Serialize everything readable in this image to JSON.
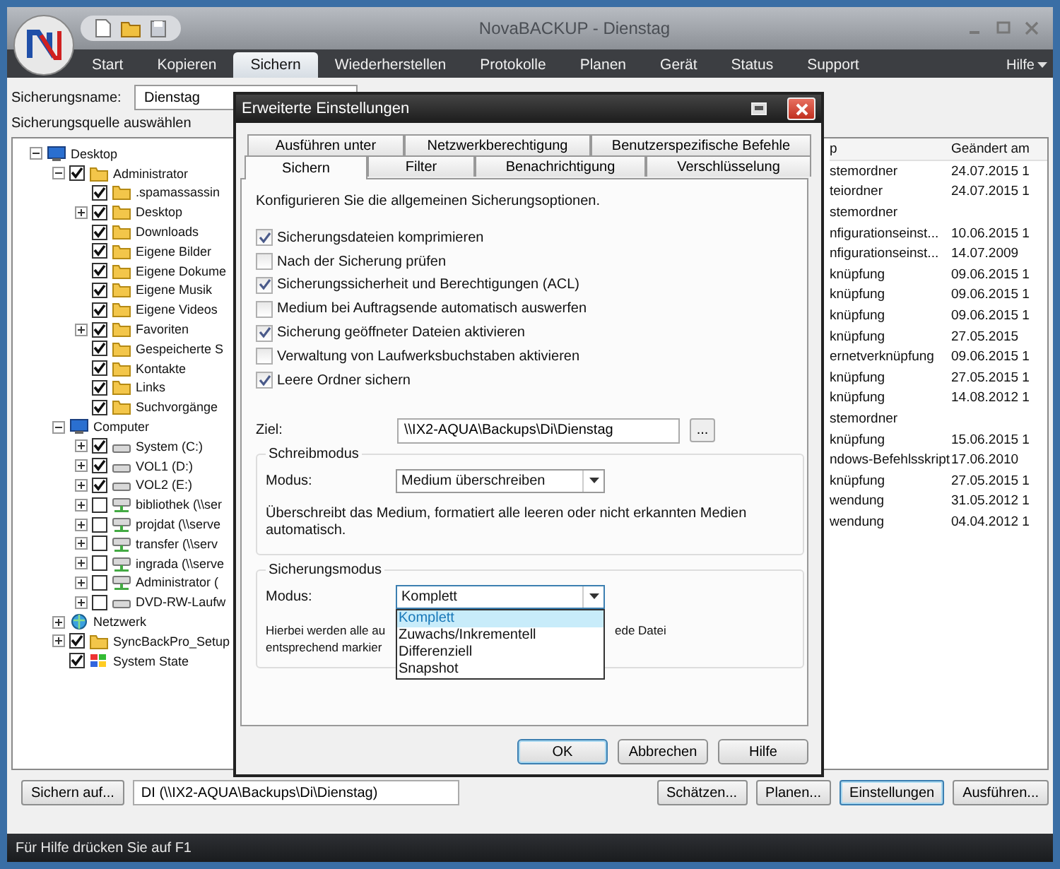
{
  "window": {
    "title": "NovaBACKUP - Dienstag"
  },
  "menu": {
    "tabs": [
      {
        "label": "Start",
        "selected": false
      },
      {
        "label": "Kopieren",
        "selected": false
      },
      {
        "label": "Sichern",
        "selected": true
      },
      {
        "label": "Wiederherstellen",
        "selected": false
      },
      {
        "label": "Protokolle",
        "selected": false
      },
      {
        "label": "Planen",
        "selected": false
      },
      {
        "label": "Gerät",
        "selected": false
      },
      {
        "label": "Status",
        "selected": false
      },
      {
        "label": "Support",
        "selected": false
      }
    ],
    "help": "Hilfe"
  },
  "backup_name": {
    "label": "Sicherungsname:",
    "value": "Dienstag"
  },
  "source_label": "Sicherungsquelle auswählen",
  "tree": [
    {
      "label": "Desktop",
      "kind": "desktop",
      "expanded": true,
      "children": [
        {
          "label": "Administrator",
          "kind": "folder",
          "checked": true,
          "expanded": true,
          "children": [
            {
              "label": ".spamassassin",
              "kind": "folder",
              "checked": true
            },
            {
              "label": "Desktop",
              "kind": "folder",
              "checked": true,
              "expanded": false
            },
            {
              "label": "Downloads",
              "kind": "folder",
              "checked": true
            },
            {
              "label": "Eigene Bilder",
              "kind": "folder",
              "checked": true
            },
            {
              "label": "Eigene Dokume",
              "kind": "folder",
              "checked": true
            },
            {
              "label": "Eigene Musik",
              "kind": "folder",
              "checked": true
            },
            {
              "label": "Eigene Videos",
              "kind": "folder",
              "checked": true
            },
            {
              "label": "Favoriten",
              "kind": "folder",
              "checked": true,
              "expanded": false
            },
            {
              "label": "Gespeicherte S",
              "kind": "folder",
              "checked": true
            },
            {
              "label": "Kontakte",
              "kind": "folder",
              "checked": true
            },
            {
              "label": "Links",
              "kind": "folder",
              "checked": true
            },
            {
              "label": "Suchvorgänge",
              "kind": "folder",
              "checked": true
            }
          ]
        },
        {
          "label": "Computer",
          "kind": "desktop",
          "expanded": true,
          "children": [
            {
              "label": "System (C:)",
              "kind": "drive",
              "checked": true,
              "expanded": false
            },
            {
              "label": "VOL1 (D:)",
              "kind": "drive",
              "checked": true,
              "expanded": false
            },
            {
              "label": "VOL2 (E:)",
              "kind": "drive",
              "checked": true,
              "expanded": false
            },
            {
              "label": "bibliothek (\\\\ser",
              "kind": "netdrive",
              "checked": false,
              "expanded": false
            },
            {
              "label": "projdat (\\\\serve",
              "kind": "netdrive",
              "checked": false,
              "expanded": false
            },
            {
              "label": "transfer (\\\\serv",
              "kind": "netdrive",
              "checked": false,
              "expanded": false
            },
            {
              "label": "ingrada (\\\\serve",
              "kind": "netdrive",
              "checked": false,
              "expanded": false
            },
            {
              "label": "Administrator (",
              "kind": "netdrive",
              "checked": false,
              "expanded": false
            },
            {
              "label": "DVD-RW-Laufw",
              "kind": "drive",
              "checked": false,
              "expanded": false
            }
          ]
        },
        {
          "label": "Netzwerk",
          "kind": "network",
          "expanded": false
        },
        {
          "label": "SyncBackPro_Setup",
          "kind": "folder",
          "checked": true,
          "expanded": false
        },
        {
          "label": "System State",
          "kind": "system",
          "checked": true
        }
      ]
    }
  ],
  "file_list": {
    "columns": [
      "p",
      "Geändert am"
    ],
    "rows": [
      {
        "column_1": "stemordner",
        "modified": "24.07.2015 1"
      },
      {
        "column_1": "teiordner",
        "modified": "24.07.2015 1"
      },
      {
        "column_1": "stemordner"
      },
      {
        "column_1": "nfigurationseinst...",
        "modified": "10.06.2015 1"
      },
      {
        "column_1": "nfigurationseinst...",
        "modified": "14.07.2009"
      },
      {
        "column_1": "knüpfung",
        "modified": "09.06.2015 1"
      },
      {
        "column_1": "knüpfung",
        "modified": "09.06.2015 1"
      },
      {
        "column_1": "knüpfung",
        "modified": "09.06.2015 1"
      },
      {
        "column_1": "knüpfung",
        "modified": "27.05.2015"
      },
      {
        "column_1": "ernetverknüpfung",
        "modified": "09.06.2015 1"
      },
      {
        "column_1": "knüpfung",
        "modified": "27.05.2015 1"
      },
      {
        "column_1": "knüpfung",
        "modified": "14.08.2012 1"
      },
      {
        "column_1": "stemordner"
      },
      {
        "column_1": "knüpfung",
        "modified": "15.06.2015 1"
      },
      {
        "column_1": "ndows-Befehlsskript",
        "modified": "17.06.2010"
      },
      {
        "column_1": "knüpfung",
        "modified": "27.05.2015 1"
      },
      {
        "column_1": "wendung",
        "modified": "31.05.2012 1"
      },
      {
        "column_1": "wendung",
        "modified": "04.04.2012 1"
      }
    ]
  },
  "bottom_bar": {
    "target_button": "Sichern auf...",
    "target_path": "DI (\\\\IX2-AQUA\\Backups\\Di\\Dienstag)",
    "buttons": [
      {
        "label": "Schätzen...",
        "focused": false
      },
      {
        "label": "Planen...",
        "focused": false
      },
      {
        "label": "Einstellungen",
        "focused": true
      },
      {
        "label": "Ausführen...",
        "focused": false
      }
    ]
  },
  "status_bar": "Für Hilfe drücken Sie auf F1",
  "dialog": {
    "title": "Erweiterte Einstellungen",
    "tab_rows": [
      [
        {
          "label": "Ausführen unter",
          "selected": false
        },
        {
          "label": "Netzwerkberechtigung",
          "selected": false
        },
        {
          "label": "Benutzerspezifische Befehle",
          "selected": false
        }
      ],
      [
        {
          "label": "Sichern",
          "selected": true
        },
        {
          "label": "Filter",
          "selected": false
        },
        {
          "label": "Benachrichtigung",
          "selected": false
        },
        {
          "label": "Verschlüsselung",
          "selected": false
        }
      ]
    ],
    "description": "Konfigurieren Sie die allgemeinen Sicherungsoptionen.",
    "options": [
      {
        "label": "Sicherungsdateien komprimieren",
        "checked": true
      },
      {
        "label": "Nach der Sicherung prüfen",
        "checked": false
      },
      {
        "label": "Sicherungssicherheit und Berechtigungen (ACL)",
        "checked": true
      },
      {
        "label": "Medium bei Auftragsende automatisch auswerfen",
        "checked": false
      },
      {
        "label": "Sicherung geöffneter Dateien aktivieren",
        "checked": true
      },
      {
        "label": "Verwaltung von Laufwerksbuchstaben aktivieren",
        "checked": false
      },
      {
        "label": "Leere Ordner sichern",
        "checked": true
      }
    ],
    "target": {
      "label": "Ziel:",
      "value": "\\\\IX2-AQUA\\Backups\\Di\\Dienstag",
      "browse": "..."
    },
    "write_mode": {
      "title": "Schreibmodus",
      "label": "Modus:",
      "value": "Medium überschreiben",
      "description": "Überschreibt das Medium, formatiert alle leeren oder nicht erkannten Medien automatisch."
    },
    "backup_mode": {
      "title": "Sicherungsmodus",
      "label": "Modus:",
      "value": "Komplett",
      "expanded": true,
      "options": [
        {
          "label": "Komplett",
          "selected": true
        },
        {
          "label": "Zuwachs/Inkrementell",
          "selected": false
        },
        {
          "label": "Differenziell",
          "selected": false
        },
        {
          "label": "Snapshot",
          "selected": false
        }
      ],
      "description_parts": [
        "Hierbei werden alle au",
        "ede Datei",
        "entsprechend markier"
      ]
    },
    "buttons": [
      {
        "label": "OK",
        "focused": true
      },
      {
        "label": "Abbrechen",
        "focused": false
      },
      {
        "label": "Hilfe",
        "focused": false
      }
    ]
  }
}
